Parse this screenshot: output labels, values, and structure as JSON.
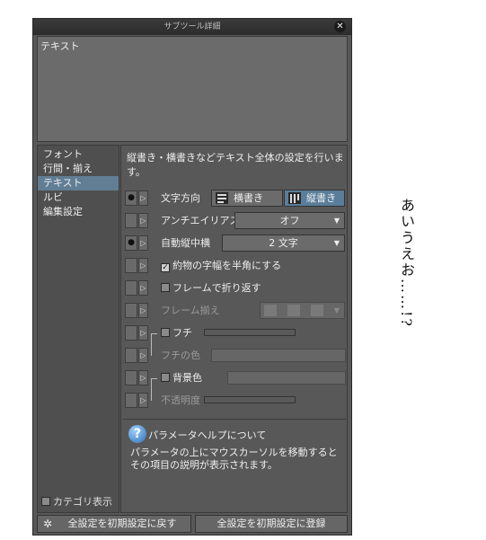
{
  "window": {
    "title": "サブツール詳細",
    "close_glyph": "✕"
  },
  "preview": {
    "text": "テキスト"
  },
  "sidebar": {
    "items": [
      {
        "label": "フォント"
      },
      {
        "label": "行間・揃え"
      },
      {
        "label": "テキスト"
      },
      {
        "label": "ルビ"
      },
      {
        "label": "編集設定"
      }
    ],
    "selected": "テキスト",
    "category_toggle_label": "カテゴリ表示"
  },
  "main": {
    "description": "縦書き・横書きなどテキスト全体の設定を行います。",
    "rows": {
      "direction": {
        "label": "文字方向",
        "horizontal": "横書き",
        "vertical": "縦書き",
        "selected": "縦書き"
      },
      "antialias": {
        "label": "アンチエイリアス",
        "value": "オフ"
      },
      "tatechuyoko": {
        "label": "自動縦中横",
        "value": "2 文字"
      },
      "halfwidth": {
        "label": "約物の字幅を半角にする",
        "checked": true
      },
      "wrap": {
        "label": "フレームで折り返す",
        "checked": false
      },
      "frame_align": {
        "label": "フレーム揃え"
      },
      "edge": {
        "label": "フチ",
        "checked": false
      },
      "edge_color": {
        "label": "フチの色"
      },
      "background": {
        "label": "背景色",
        "checked": false
      },
      "opacity": {
        "label": "不透明度"
      }
    }
  },
  "help": {
    "title": "パラメータヘルプについて",
    "text": "パラメータの上にマウスカーソルを移動するとその項目の説明が表示されます。"
  },
  "footer": {
    "reset_label": "全設定を初期設定に戻す",
    "register_label": "全設定を初期設定に登録"
  },
  "canvas_text": "あいうえお……!?",
  "colors": {
    "selection": "#617e95",
    "panel": "#585858",
    "vertical_active": "#5a7e9a"
  }
}
